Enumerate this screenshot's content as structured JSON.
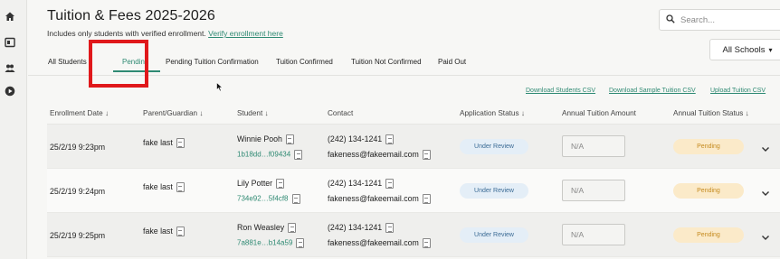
{
  "page": {
    "title": "Tuition & Fees 2025-2026",
    "subtitle": "Includes only students with verified enrollment.",
    "verify_link": "Verify enrollment here"
  },
  "search": {
    "placeholder": "Search..."
  },
  "school_select": {
    "value": "All Schools"
  },
  "tabs": [
    {
      "label": "All Students",
      "active": false
    },
    {
      "label": "Pending",
      "active": true
    },
    {
      "label": "Pending Tuition Confirmation",
      "active": false
    },
    {
      "label": "Tuition Confirmed",
      "active": false
    },
    {
      "label": "Tuition Not Confirmed",
      "active": false
    },
    {
      "label": "Paid Out",
      "active": false
    }
  ],
  "csv_links": [
    "Download Students CSV",
    "Download Sample Tuition CSV",
    "Upload Tuition CSV"
  ],
  "table": {
    "headers": [
      "Enrollment Date ↓",
      "Parent/Guardian ↓",
      "Student ↓",
      "Contact",
      "Application Status ↓",
      "Annual Tuition Amount",
      "Annual Tuition Status ↓"
    ],
    "rows": [
      {
        "date": "25/2/19 9:23pm",
        "parent": "fake last",
        "student": "Winnie Pooh",
        "student_id": "1b18dd…f09434",
        "phone": "(242) 134-1241",
        "email": "fakeness@fakeemail.com",
        "app_status": "Under Review",
        "tuition_amount": "N/A",
        "tuition_status": "Pending"
      },
      {
        "date": "25/2/19 9:24pm",
        "parent": "fake last",
        "student": "Lily Potter",
        "student_id": "734e92…5f4cf8",
        "phone": "(242) 134-1241",
        "email": "fakeness@fakeemail.com",
        "app_status": "Under Review",
        "tuition_amount": "N/A",
        "tuition_status": "Pending"
      },
      {
        "date": "25/2/19 9:25pm",
        "parent": "fake last",
        "student": "Ron Weasley",
        "student_id": "7a881e…b14a59",
        "phone": "(242) 134-1241",
        "email": "fakeness@fakeemail.com",
        "app_status": "Under Review",
        "tuition_amount": "N/A",
        "tuition_status": "Pending"
      }
    ]
  },
  "colors": {
    "accent": "#2f8a73",
    "highlight": "#e0181b",
    "app_status_bg": "#e4eef7",
    "tuition_status_bg": "#fbeac9"
  },
  "icons": [
    "home-icon",
    "dashboard-icon",
    "people-icon",
    "play-icon",
    "search-icon",
    "document-icon",
    "chevron-down-icon"
  ]
}
